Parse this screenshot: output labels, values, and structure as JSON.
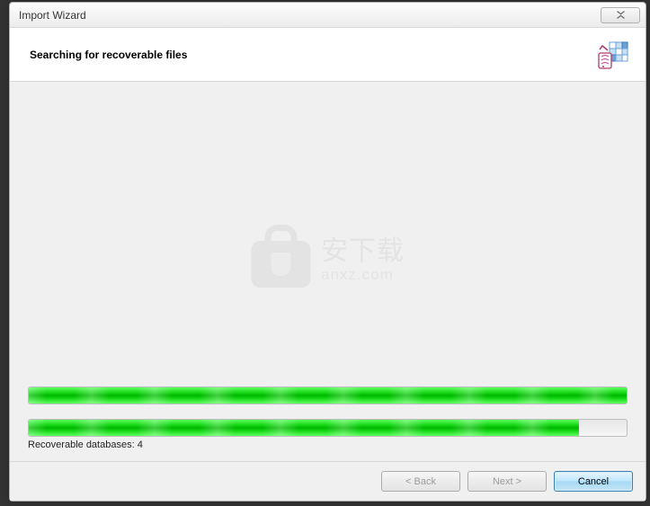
{
  "window": {
    "title": "Import Wizard"
  },
  "header": {
    "heading": "Searching for recoverable files"
  },
  "progress": {
    "bar1_percent": 100,
    "bar2_percent": 92,
    "status_label": "Recoverable databases:",
    "status_count": "4"
  },
  "buttons": {
    "back": "< Back",
    "next": "Next >",
    "cancel": "Cancel"
  },
  "watermark": {
    "cn": "安下载",
    "en": "anxz.com"
  }
}
